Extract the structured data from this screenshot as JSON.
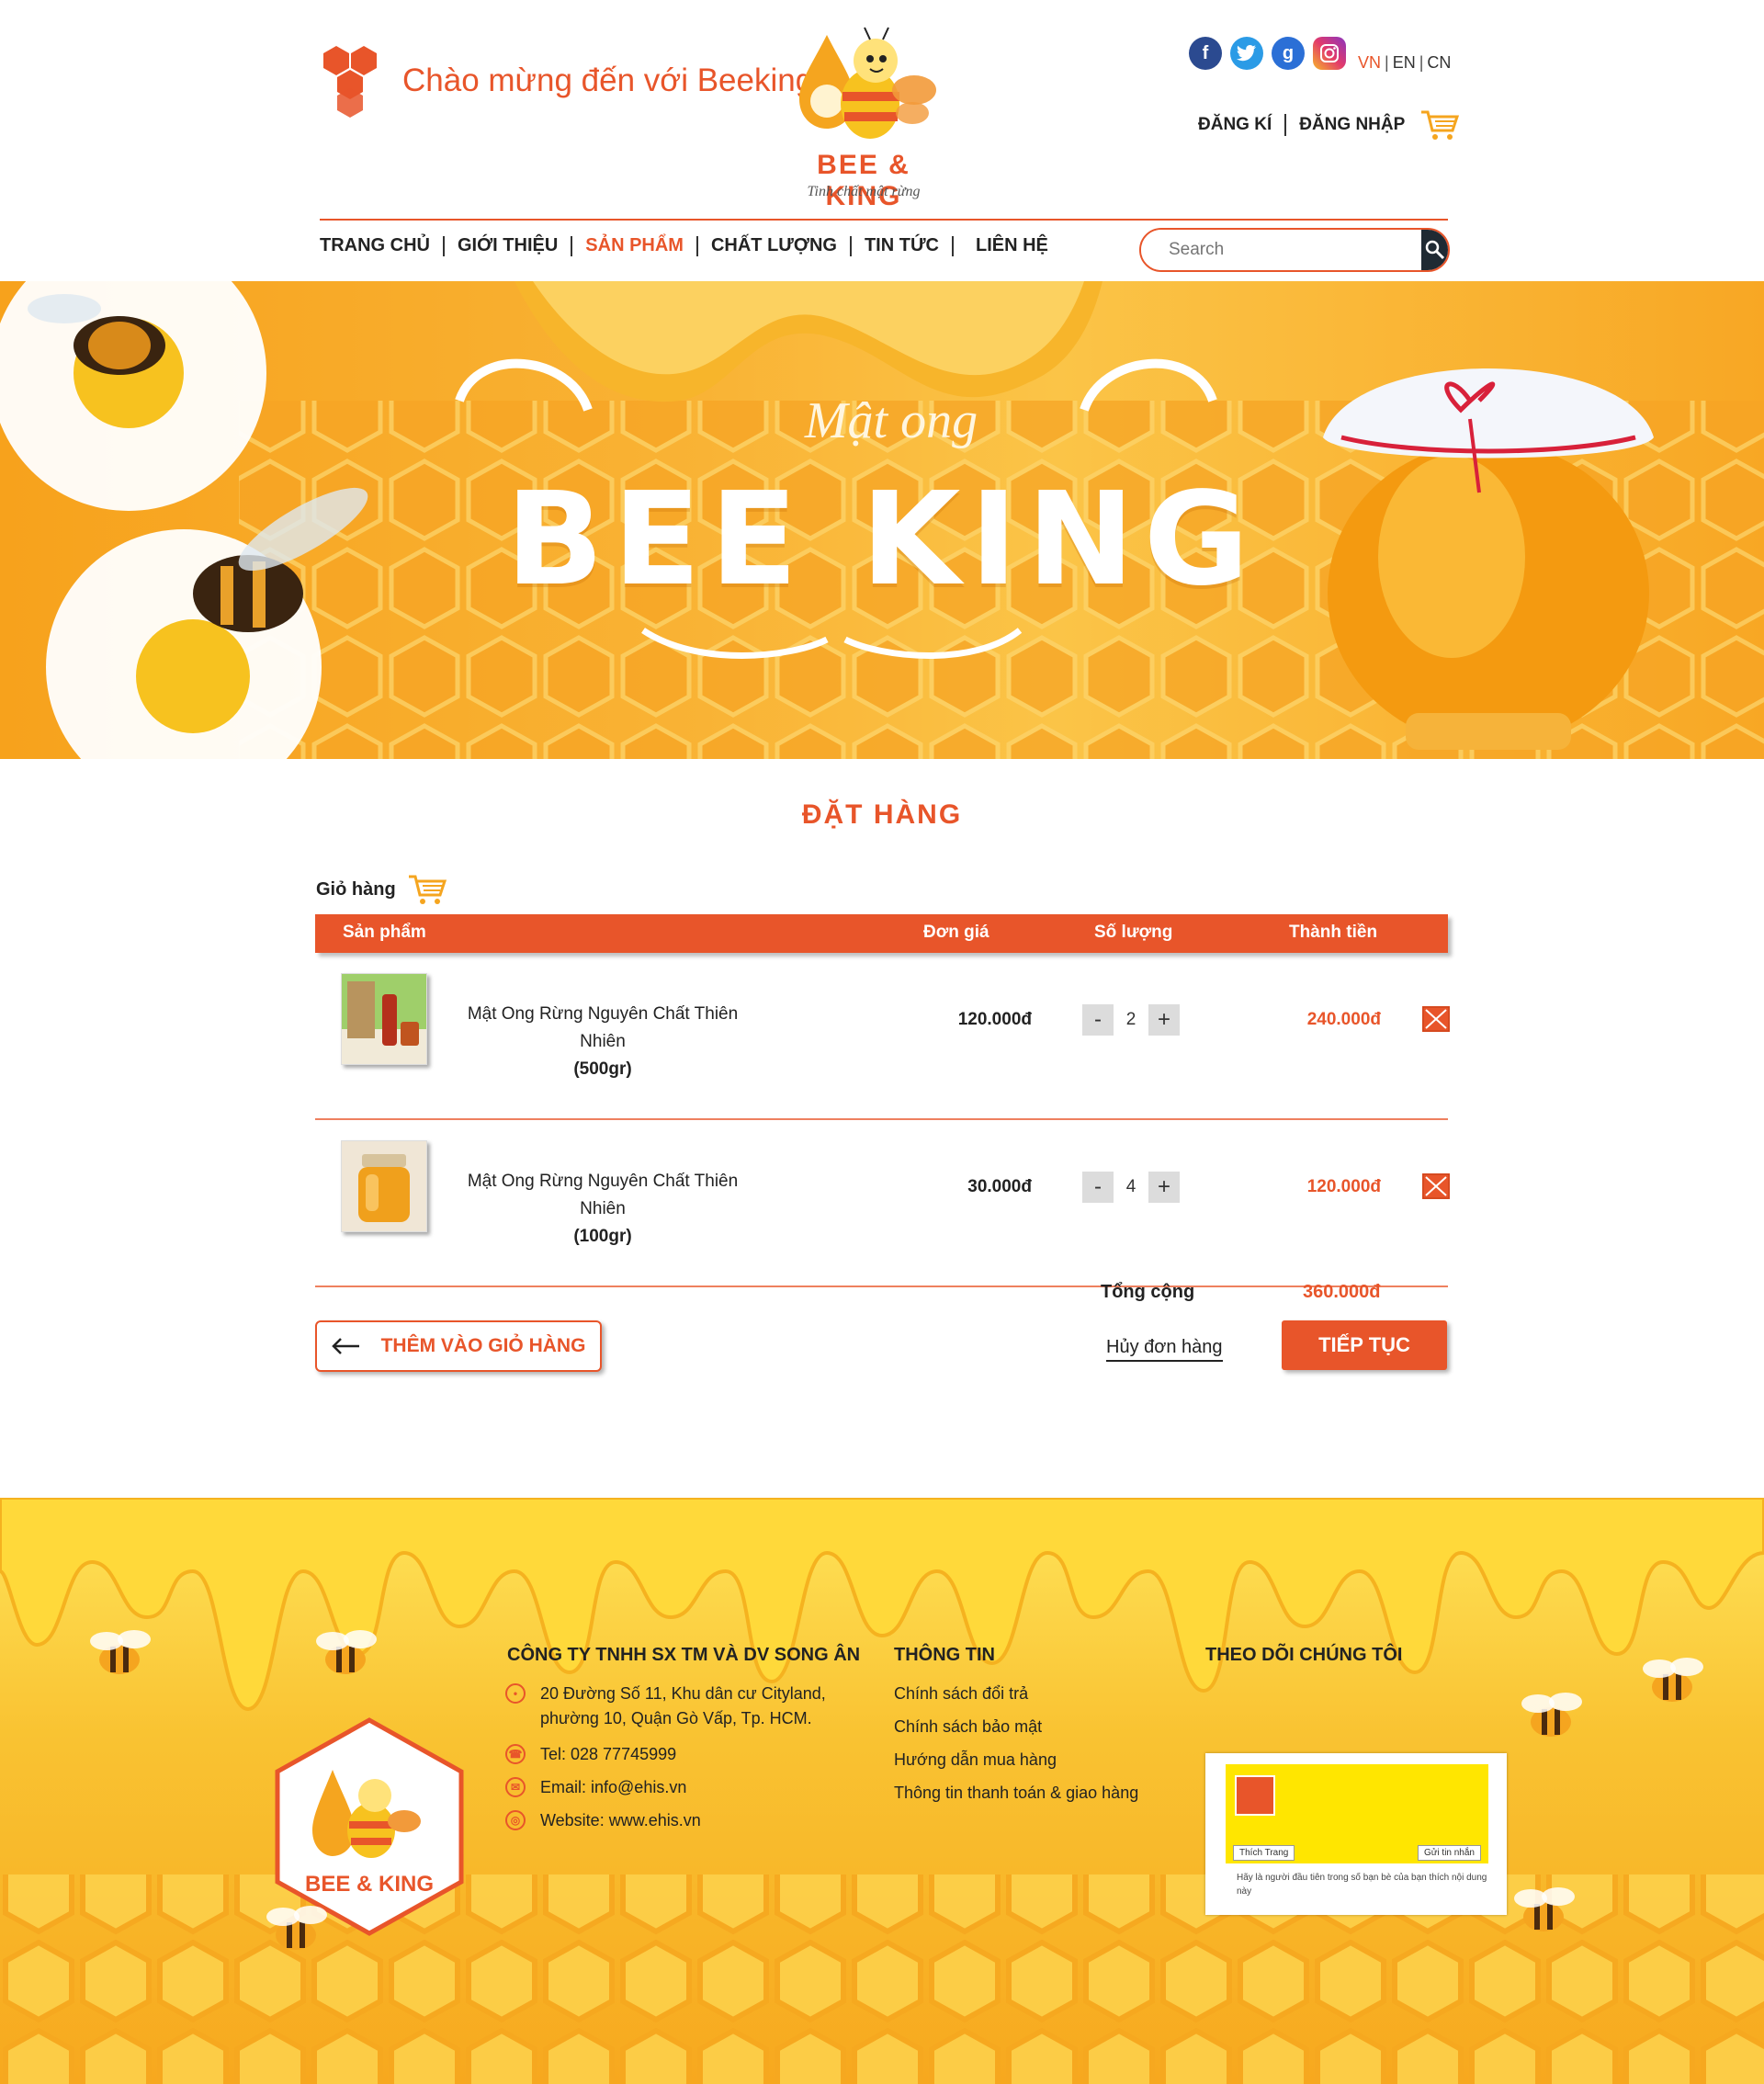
{
  "header": {
    "welcome": "Chào mừng đến với Beeking",
    "brand_name": "BEE & KING",
    "brand_tagline": "Tinh chất mật rừng",
    "languages": [
      "VN",
      "EN",
      "CN"
    ],
    "auth": {
      "register": "ĐĂNG KÍ",
      "login": "ĐĂNG NHẬP"
    },
    "nav": [
      "TRANG CHỦ",
      "GIỚI THIỆU",
      "SẢN PHẨM",
      "CHẤT LƯỢNG",
      "TIN TỨC",
      "LIÊN HỆ"
    ],
    "nav_active": "SẢN PHẨM",
    "search_placeholder": "Search"
  },
  "banner": {
    "small": "Mật ong",
    "big": "BEE KING"
  },
  "order": {
    "title": "ĐẶT HÀNG",
    "cart_label": "Giỏ hàng",
    "columns": {
      "product": "Sản phẩm",
      "unit_price": "Đơn giá",
      "quantity": "Số lượng",
      "line_total": "Thành tiền"
    },
    "items": [
      {
        "name": "Mật Ong Rừng Nguyên Chất Thiên Nhiên",
        "weight": "(500gr)",
        "price": "120.000đ",
        "qty": "2",
        "total": "240.000đ"
      },
      {
        "name": "Mật Ong Rừng Nguyên Chất Thiên Nhiên",
        "weight": "(100gr)",
        "price": "30.000đ",
        "qty": "4",
        "total": "120.000đ"
      }
    ],
    "total_label": "Tổng cộng",
    "total_value": "360.000đ",
    "back_button": "THÊM VÀO GIỎ HÀNG",
    "cancel": "Hủy đơn hàng",
    "continue_button": "TIẾP TỤC"
  },
  "footer": {
    "company": "CÔNG TY TNHH SX TM VÀ DV SONG ÂN",
    "address": "20 Đường Số 11, Khu dân cư Cityland, phường 10, Quận Gò Vấp, Tp. HCM.",
    "tel": "Tel: 028 77745999",
    "email": "Email: info@ehis.vn",
    "website": "Website: www.ehis.vn",
    "info_title": "THÔNG TIN",
    "info_links": [
      "Chính sách đổi trả",
      "Chính sách bảo mật",
      "Hướng dẫn mua hàng",
      "Thông tin thanh toán & giao hàng"
    ],
    "follow_title": "THEO DÕI CHÚNG TÔI",
    "fb_like": "Thích Trang",
    "fb_message": "Gửi tin nhắn",
    "fb_note": "Hãy là người đầu tiên trong số bạn bè của bạn thích nội dung này"
  },
  "colors": {
    "accent": "#e8552a",
    "honey": "#f9b335",
    "dark": "#1f2a33"
  }
}
